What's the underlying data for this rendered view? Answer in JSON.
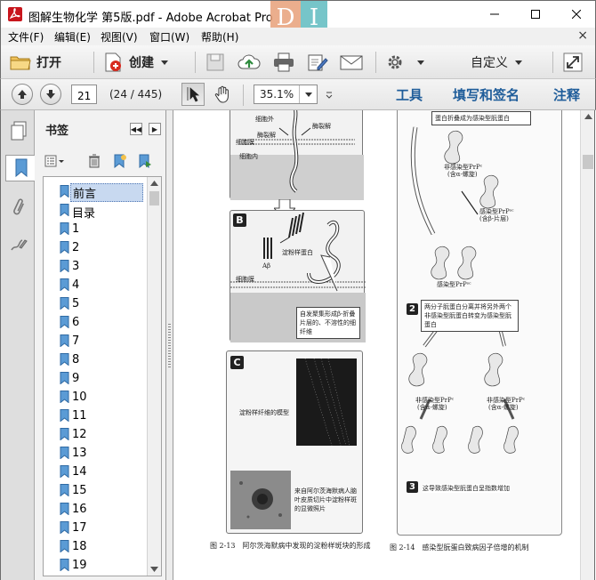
{
  "window": {
    "title": "图解生物化学 第5版.pdf - Adobe Acrobat Pro",
    "ghost_letters": [
      "D",
      "I"
    ]
  },
  "menu": [
    "文件(F)",
    "编辑(E)",
    "视图(V)",
    "窗口(W)",
    "帮助(H)"
  ],
  "toolbar": {
    "open_label": "打开",
    "create_label": "创建",
    "customize_label": "自定义"
  },
  "nav": {
    "page_value": "21",
    "page_count": "(24 / 445)",
    "zoom": "35.1%",
    "tools_label": "工具",
    "fill_sign_label": "填写和签名",
    "comment_label": "注释"
  },
  "bookmarks": {
    "title": "书签",
    "items": [
      "前言",
      "目录",
      "1",
      "2",
      "3",
      "4",
      "5",
      "6",
      "7",
      "8",
      "9",
      "10",
      "11",
      "12",
      "13",
      "14",
      "15",
      "16",
      "17",
      "18",
      "19"
    ],
    "selected": "前言"
  },
  "page": {
    "fig_a_labels": [
      "细胞外",
      "细胞膜",
      "细胞内",
      "酶裂解",
      "酶裂解"
    ],
    "fig_b_letter": "B",
    "fig_b_labels": [
      "淀粉样蛋白",
      "Aβ",
      "细胞膜"
    ],
    "fig_b_note": "自发聚集形成β-折叠片层的、不溶性的细纤维",
    "fig_c_letter": "C",
    "fig_c_label": "淀粉样纤维的模型",
    "fig_c_note": "来自阿尔茨海默病人脑叶皮质切片中淀粉样斑的显微照片",
    "caption_left": "图 2-13　阿尔茨海默病中发现的淀粉样斑块的形成",
    "right_top_note": "蛋白折叠成为感染型朊蛋白",
    "right_labels": [
      "非感染型PrPᶜ",
      "(含α-螺旋)",
      "感染型PrPˢᶜ",
      "(含β-片层)",
      "感染型PrPˢᶜ"
    ],
    "step2_num": "2",
    "step2_text": "两分子朊蛋白分离并将另外两个非感染型朊蛋白转变为感染型朊蛋白",
    "right_labels2": [
      "非感染型PrPᶜ",
      "(含α-螺旋)",
      "非感染型PrPᶜ",
      "(含α-螺旋)"
    ],
    "step3_num": "3",
    "step3_text": "这导致感染型朊蛋白呈指数增加",
    "caption_right": "图 2-14　感染型朊蛋白致病因子倍增的机制"
  }
}
